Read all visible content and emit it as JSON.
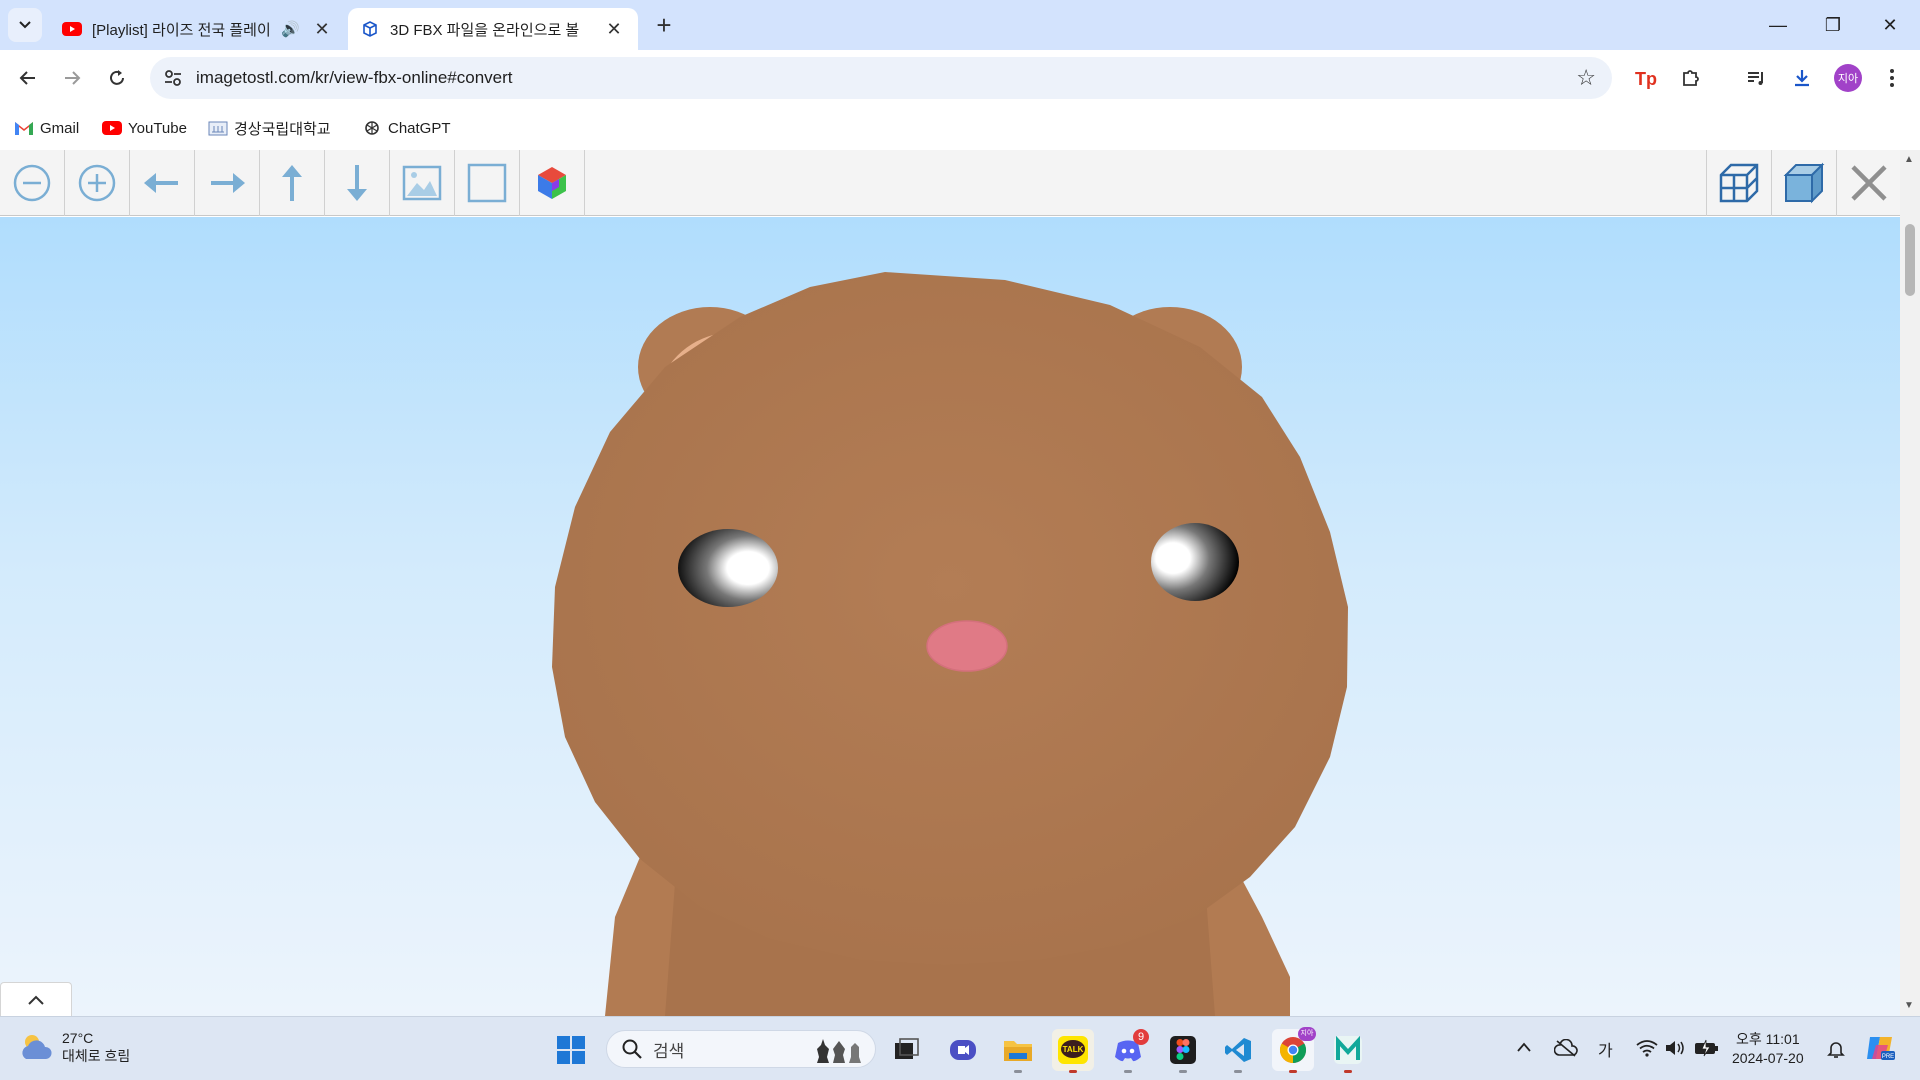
{
  "tabs": [
    {
      "title": "[Playlist] 라이즈 전국 플레이",
      "favicon": "youtube-icon",
      "audio": true
    },
    {
      "title": "3D FBX 파일을 온라인으로 볼",
      "favicon": "cube-icon",
      "active": true
    }
  ],
  "window_controls": {
    "minimize": "—",
    "restore": "❐",
    "close": "✕"
  },
  "address": {
    "url": "imagetostl.com/kr/view-fbx-online#convert"
  },
  "profile": {
    "initials": "지아"
  },
  "bookmarks": [
    {
      "label": "Gmail",
      "icon": "gmail-icon"
    },
    {
      "label": "YouTube",
      "icon": "youtube-icon"
    },
    {
      "label": "경상국립대학교",
      "icon": "university-icon"
    },
    {
      "label": "ChatGPT",
      "icon": "chatgpt-icon"
    }
  ],
  "viewer": {
    "left_tools": [
      "zoom-out",
      "zoom-in",
      "move-left",
      "move-right",
      "move-up",
      "move-down",
      "background-image",
      "background-none",
      "color-mode"
    ],
    "right_tools": [
      "wireframe-view",
      "solid-view",
      "close-viewer"
    ],
    "model_colors": {
      "fur": "#b07a52",
      "ear_inner": "#e7b08b",
      "nose": "#e07a86",
      "eye": "#000000"
    }
  },
  "taskbar": {
    "weather": {
      "temp": "27°C",
      "desc": "대체로 흐림"
    },
    "search_placeholder": "검색",
    "apps": [
      "task-view",
      "meet",
      "file-explorer",
      "kakaotalk",
      "discord",
      "figma",
      "vscode",
      "chrome",
      "maker"
    ],
    "discord_badge": "9",
    "ime": "가",
    "clock": {
      "time": "오후 11:01",
      "date": "2024-07-20"
    }
  }
}
